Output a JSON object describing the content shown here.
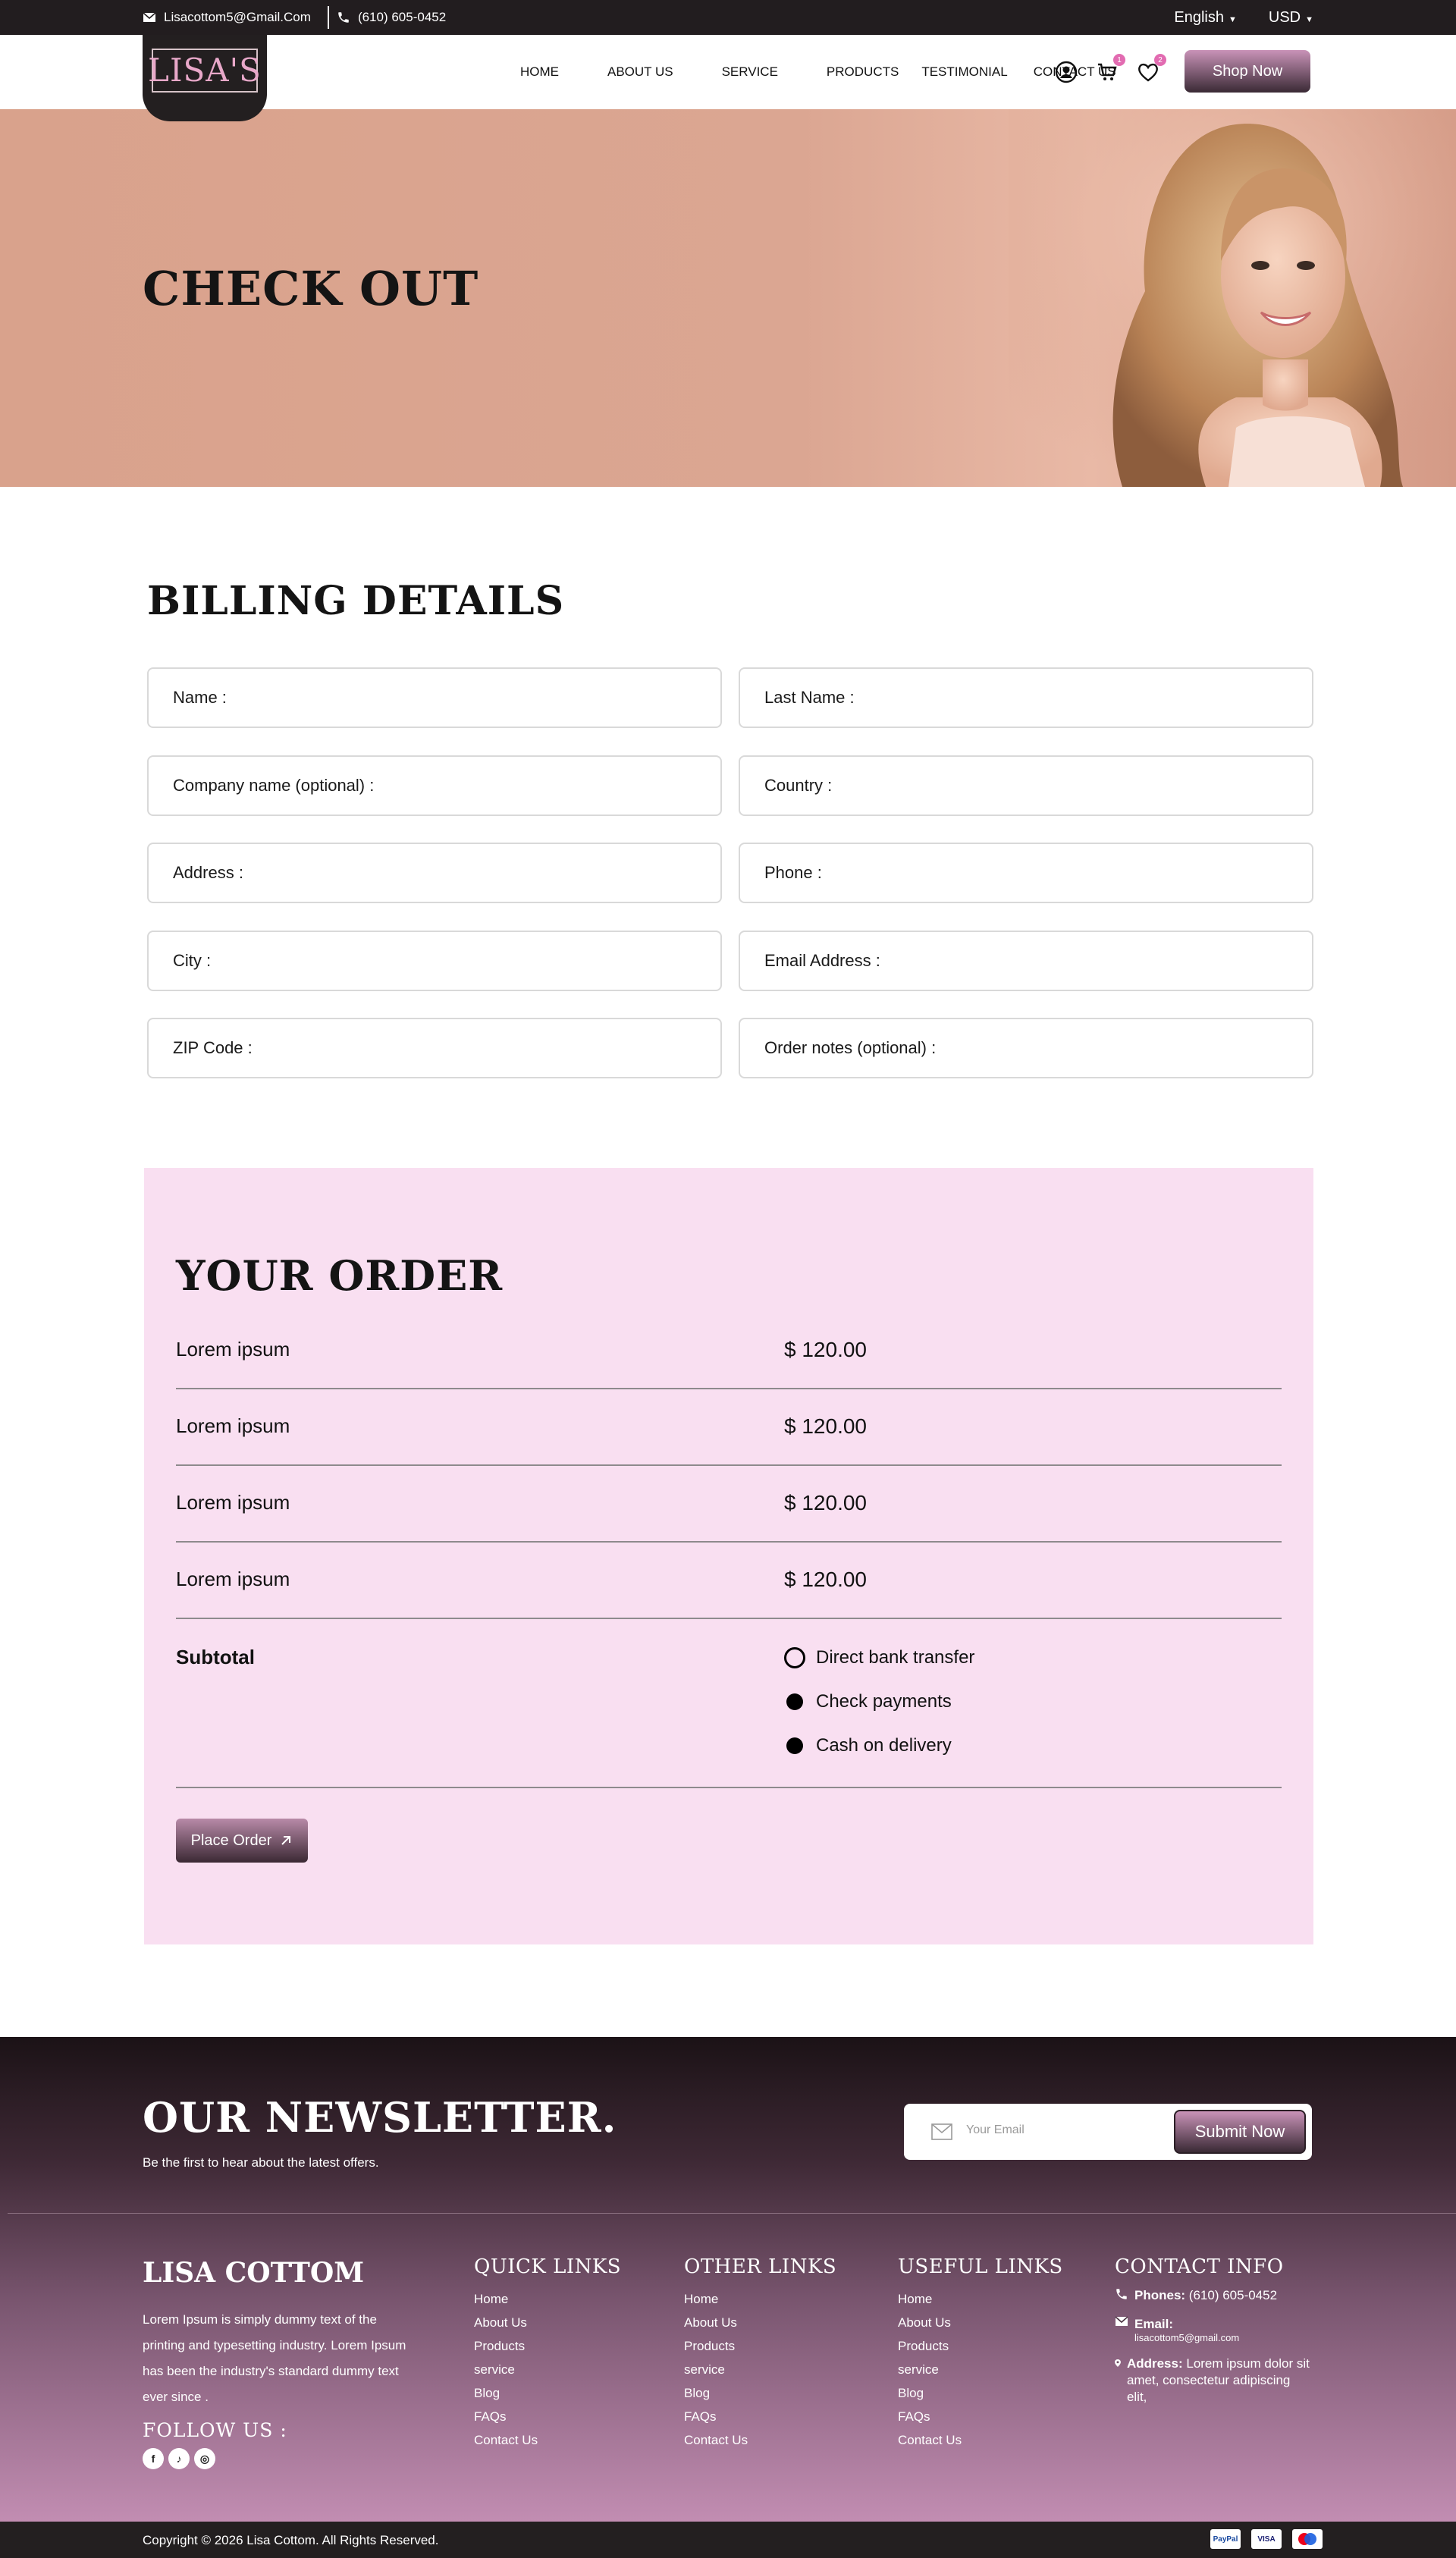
{
  "topbar": {
    "email": "Lisacottom5@Gmail.Com",
    "phone": "(610) 605-0452",
    "language": "English",
    "currency": "USD"
  },
  "header": {
    "logo_text": "LISA'S",
    "nav": [
      "HOME",
      "ABOUT US",
      "SERVICE",
      "PRODUCTS",
      "TESTIMONIAL",
      "CONTACT US"
    ],
    "cart_count": "1",
    "wishlist_count": "2",
    "shop_button": "Shop Now"
  },
  "hero": {
    "title": "CHECK OUT"
  },
  "billing": {
    "title": "BILLING DETAILS",
    "fields": [
      "Name :",
      "Last Name :",
      "Company name (optional) :",
      "Country :",
      "Address :",
      "Phone :",
      "City :",
      "Email Address :",
      "ZIP Code :",
      "Order notes (optional) :"
    ]
  },
  "order": {
    "title": "YOUR ORDER",
    "items": [
      {
        "name": "Lorem ipsum",
        "price": "$ 120.00"
      },
      {
        "name": "Lorem ipsum",
        "price": "$ 120.00"
      },
      {
        "name": "Lorem ipsum",
        "price": "$ 120.00"
      },
      {
        "name": "Lorem ipsum",
        "price": "$ 120.00"
      }
    ],
    "subtotal_label": "Subtotal",
    "payment_options": [
      "Direct bank transfer",
      "Check payments",
      "Cash on delivery"
    ],
    "selected_payment": "Direct bank transfer",
    "place_order": "Place Order"
  },
  "newsletter": {
    "title": "OUR NEWSLETTER.",
    "subtitle": "Be the first to hear about the latest offers.",
    "placeholder": "Your Email",
    "submit": "Submit Now"
  },
  "footer": {
    "brand": "LISA COTTOM",
    "description": "Lorem Ipsum is simply dummy text of the printing and typesetting industry. Lorem Ipsum has been the industry's standard dummy text ever since .",
    "follow": "FOLLOW US :",
    "socials": [
      "facebook-icon",
      "tiktok-icon",
      "instagram-icon"
    ],
    "quick_links": {
      "title": "QUICK LINKS",
      "items": [
        "Home",
        "About Us",
        "Products",
        "service",
        "Blog",
        "FAQs",
        "Contact Us"
      ]
    },
    "other_links": {
      "title": "OTHER LINKS",
      "items": [
        "Home",
        "About Us",
        "Products",
        "service",
        "Blog",
        "FAQs",
        "Contact Us"
      ]
    },
    "useful_links": {
      "title": "USEFUL LINKS",
      "items": [
        "Home",
        "About Us",
        "Products",
        "service",
        "Blog",
        "FAQs",
        "Contact Us"
      ]
    },
    "contact": {
      "title": "CONTACT INFO",
      "phones_label": "Phones:",
      "phones": "(610) 605-0452",
      "email_label": "Email:",
      "email": "lisacottom5@gmail.com",
      "address_label": "Address:",
      "address": "Lorem ipsum dolor sit amet, consectetur adipiscing elit,"
    },
    "copyright": "Copyright © 2026 Lisa Cottom. All Rights Reserved.",
    "payment_cards": [
      "PayPal",
      "VISA",
      "MC"
    ]
  },
  "colors": {
    "dark": "#231f20",
    "hero_bg": "#d9a28c",
    "order_bg": "#f9dff1",
    "accent_pink": "#c993b8",
    "badge": "#e26bb1"
  }
}
